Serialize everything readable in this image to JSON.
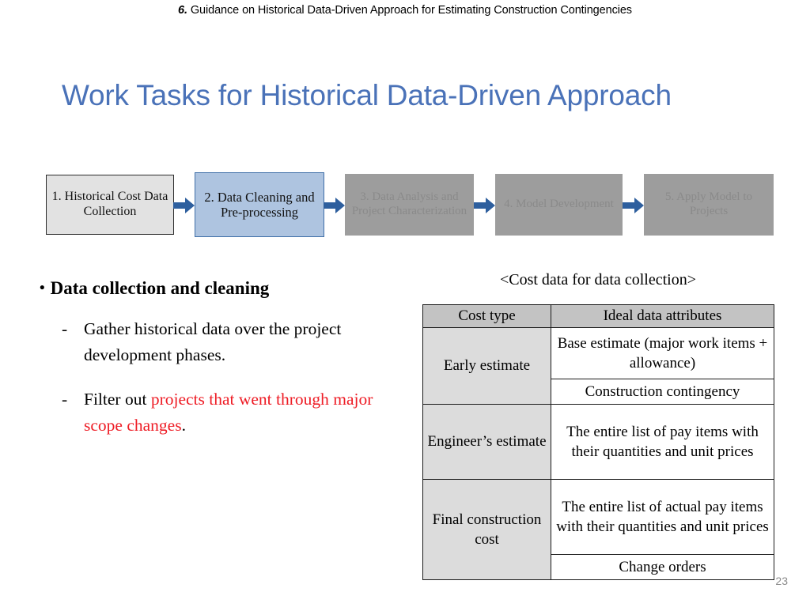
{
  "header": {
    "number": "6.",
    "text": " Guidance on Historical Data-Driven Approach for Estimating Construction Contingencies"
  },
  "title": "Work Tasks for Historical Data-Driven Approach",
  "process_flow": {
    "arrow_icon": "right-arrow-icon",
    "steps": [
      {
        "label": "1. Historical Cost Data Collection",
        "state": "normal",
        "fill": "#e2e2e2",
        "text_color": "#111111"
      },
      {
        "label": "2. Data Cleaning and Pre-processing",
        "state": "active",
        "fill": "#aec4e0",
        "text_color": "#111111"
      },
      {
        "label": "3. Data Analysis and Project Characterization",
        "state": "dimmed",
        "fill": "#9d9d9d",
        "text_color": "#8a8a8a"
      },
      {
        "label": "4. Model Development",
        "state": "dimmed",
        "fill": "#9d9d9d",
        "text_color": "#8a8a8a"
      },
      {
        "label": "5. Apply Model to Projects",
        "state": "dimmed",
        "fill": "#9d9d9d",
        "text_color": "#8a8a8a"
      }
    ],
    "arrow_color": "#2e5f9e"
  },
  "bullets": {
    "dot": "•",
    "main": "Data collection and cleaning",
    "dash": "-",
    "sub": [
      {
        "plain": "Gather historical data over the project development phases.",
        "lead": "Gather historical data over the project development phases.",
        "highlight": "",
        "tail": ""
      },
      {
        "plain": "Filter out projects that went through major scope changes.",
        "lead": "Filter out ",
        "highlight": "projects that went through major scope changes",
        "tail": "."
      }
    ],
    "highlight_color": "#ee1c25"
  },
  "table": {
    "caption": "<Cost data for data collection>",
    "headers": [
      "Cost type",
      "Ideal data attributes"
    ],
    "rows": [
      {
        "type": "Early estimate",
        "attributes": [
          "Base estimate (major work items + allowance)",
          "Construction contingency"
        ]
      },
      {
        "type": "Engineer’s estimate",
        "attributes": [
          "The entire list of pay items with their quantities and unit prices"
        ]
      },
      {
        "type": "Final construction cost",
        "attributes": [
          "The entire list of actual pay items with their quantities and unit prices",
          "Change orders"
        ]
      }
    ],
    "header_fill": "#c3c3c3",
    "type_cell_fill": "#dcdcdc"
  },
  "page_number": "23"
}
